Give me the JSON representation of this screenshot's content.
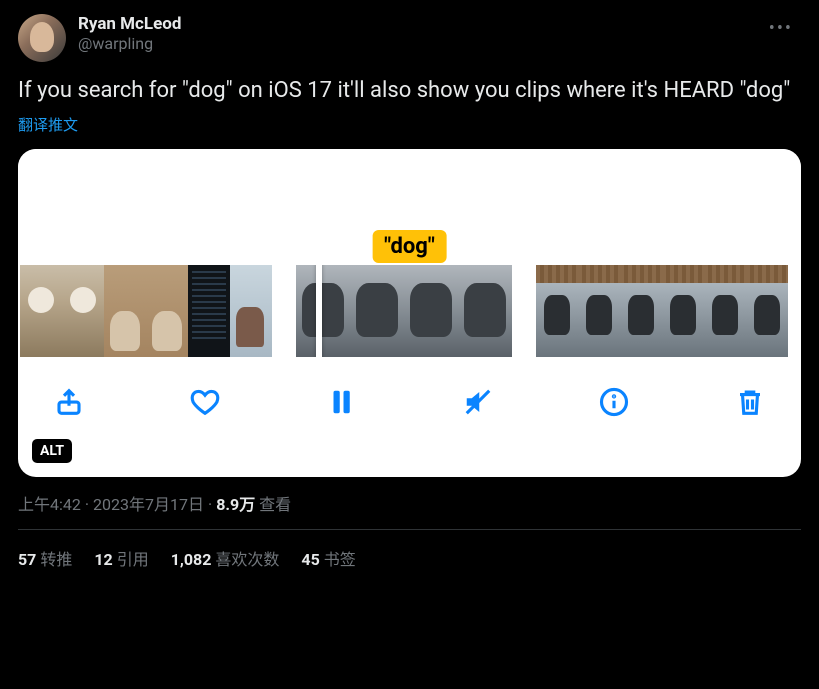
{
  "author": {
    "display_name": "Ryan McLeod",
    "handle": "@warpling"
  },
  "tweet_text": "If you search for \"dog\" on iOS 17 it'll also show you clips where it's HEARD \"dog\"",
  "translate_label": "翻译推文",
  "media": {
    "caption_bubble": "\"dog\"",
    "alt_badge": "ALT"
  },
  "meta": {
    "time": "上午4:42",
    "date": "2023年7月17日",
    "views_count": "8.9万",
    "views_label": "查看"
  },
  "stats": {
    "retweets_count": "57",
    "retweets_label": "转推",
    "quotes_count": "12",
    "quotes_label": "引用",
    "likes_count": "1,082",
    "likes_label": "喜欢次数",
    "bookmarks_count": "45",
    "bookmarks_label": "书签"
  }
}
